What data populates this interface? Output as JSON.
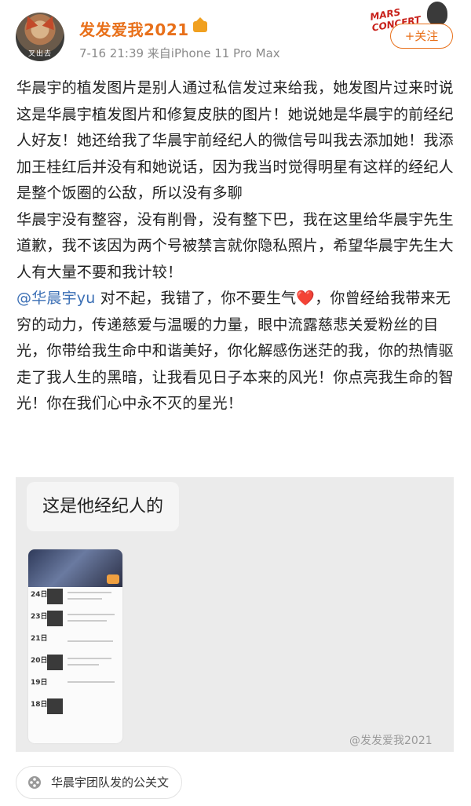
{
  "header": {
    "username": "发发爱我2021",
    "meta": "7-16 21:39  来自iPhone 11 Pro Max",
    "follow_label": "+关注",
    "avatar_caption": "叉出去",
    "badge_text": "MARS CONCERT"
  },
  "post": {
    "paragraph1": "华晨宇的植发图片是别人通过私信发过来给我，她发图片过来时说这是华晨宇植发图片和修复皮肤的图片！她说她是华晨宇的前经纪人好友！她还给我了华晨宇前经纪人的微信号叫我去添加她！我添加王桂红后并没有和她说话，因为我当时觉得明星有这样的经纪人是整个饭圈的公敌，所以没有多聊",
    "paragraph2": "华晨宇没有整容，没有削骨，没有整下巴，我在这里给华晨宇先生道歉，我不该因为两个号被禁言就你隐私照片，希望华晨宇先生大人有大量不要和我计较！",
    "mention": "@华晨宇yu",
    "paragraph3_a": " 对不起，我错了，你不要生气",
    "heart": "❤️",
    "paragraph3_b": "，你曾经给我带来无穷的动力，传递慈爱与温暖的力量，眼中流露慈悲关爱粉丝的目光，你带给我生命中和谐美好，你化解感伤迷茫的我，你的热情驱走了我人生的黑暗，让我看见日子本来的风光！你点亮我生命的智光！你在我们心中永不灭的星光！"
  },
  "image": {
    "bubble_text": "这是他经纪人的",
    "phone_dates": [
      "24日",
      "23日",
      "21日",
      "20日",
      "19日",
      "18日"
    ],
    "watermark": "@发发爱我2021"
  },
  "footer": {
    "topic_label": "华晨宇团队发的公关文",
    "icon": "location-icon"
  },
  "colors": {
    "accent": "#e8701a",
    "link": "#3b6fb5",
    "heart": "#e3352d"
  }
}
